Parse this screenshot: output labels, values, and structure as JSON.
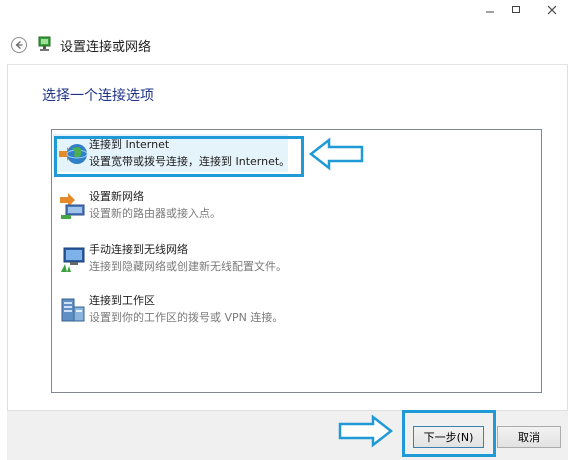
{
  "window": {
    "title": "设置连接或网络",
    "controls": {
      "minimize": "minimize-icon",
      "maximize": "maximize-icon",
      "close": "close-icon"
    }
  },
  "main": {
    "heading": "选择一个连接选项",
    "options": [
      {
        "title": "连接到 Internet",
        "description": "设置宽带或拨号连接，连接到 Internet。",
        "icon": "globe-icon",
        "selected": true
      },
      {
        "title": "设置新网络",
        "description": "设置新的路由器或接入点。",
        "icon": "new-network-icon",
        "selected": false
      },
      {
        "title": "手动连接到无线网络",
        "description": "连接到隐藏网络或创建新无线配置文件。",
        "icon": "wireless-network-icon",
        "selected": false
      },
      {
        "title": "连接到工作区",
        "description": "设置到你的工作区的拨号或 VPN 连接。",
        "icon": "workplace-icon",
        "selected": false
      }
    ]
  },
  "footer": {
    "next_label": "下一步(N)",
    "cancel_label": "取消"
  },
  "colors": {
    "highlight": "#1f9ad6",
    "heading": "#1e3287",
    "selection": "#e5f3fb"
  }
}
